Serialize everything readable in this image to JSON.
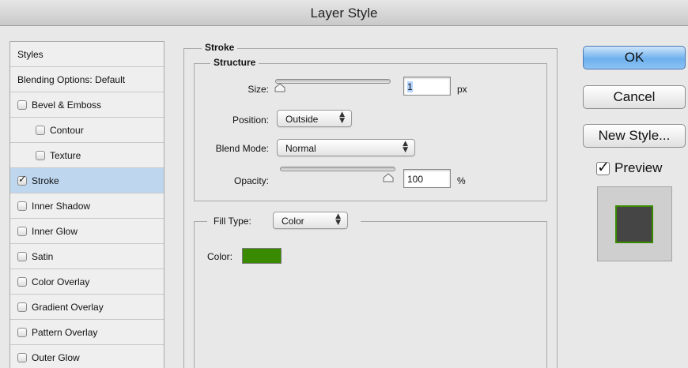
{
  "window": {
    "title": "Layer Style"
  },
  "styles_list": [
    {
      "label": "Styles",
      "has_checkbox": false,
      "checked": false,
      "indent": false,
      "selected": false
    },
    {
      "label": "Blending Options: Default",
      "has_checkbox": false,
      "checked": false,
      "indent": false,
      "selected": false
    },
    {
      "label": "Bevel & Emboss",
      "has_checkbox": true,
      "checked": false,
      "indent": false,
      "selected": false
    },
    {
      "label": "Contour",
      "has_checkbox": true,
      "checked": false,
      "indent": true,
      "selected": false
    },
    {
      "label": "Texture",
      "has_checkbox": true,
      "checked": false,
      "indent": true,
      "selected": false
    },
    {
      "label": "Stroke",
      "has_checkbox": true,
      "checked": true,
      "indent": false,
      "selected": true
    },
    {
      "label": "Inner Shadow",
      "has_checkbox": true,
      "checked": false,
      "indent": false,
      "selected": false
    },
    {
      "label": "Inner Glow",
      "has_checkbox": true,
      "checked": false,
      "indent": false,
      "selected": false
    },
    {
      "label": "Satin",
      "has_checkbox": true,
      "checked": false,
      "indent": false,
      "selected": false
    },
    {
      "label": "Color Overlay",
      "has_checkbox": true,
      "checked": false,
      "indent": false,
      "selected": false
    },
    {
      "label": "Gradient Overlay",
      "has_checkbox": true,
      "checked": false,
      "indent": false,
      "selected": false
    },
    {
      "label": "Pattern Overlay",
      "has_checkbox": true,
      "checked": false,
      "indent": false,
      "selected": false
    },
    {
      "label": "Outer Glow",
      "has_checkbox": true,
      "checked": false,
      "indent": false,
      "selected": false
    }
  ],
  "stroke": {
    "title": "Stroke",
    "structure": {
      "title": "Structure",
      "size_label": "Size:",
      "size_value": "1",
      "size_unit": "px",
      "position_label": "Position:",
      "position_value": "Outside",
      "blend_mode_label": "Blend Mode:",
      "blend_mode_value": "Normal",
      "opacity_label": "Opacity:",
      "opacity_value": "100",
      "opacity_unit": "%"
    },
    "fill": {
      "fill_type_label": "Fill Type:",
      "fill_type_value": "Color",
      "color_label": "Color:",
      "color": "#3a8a00"
    }
  },
  "buttons": {
    "ok": "OK",
    "cancel": "Cancel",
    "new_style": "New Style...",
    "preview_label": "Preview",
    "preview_checked": true
  }
}
